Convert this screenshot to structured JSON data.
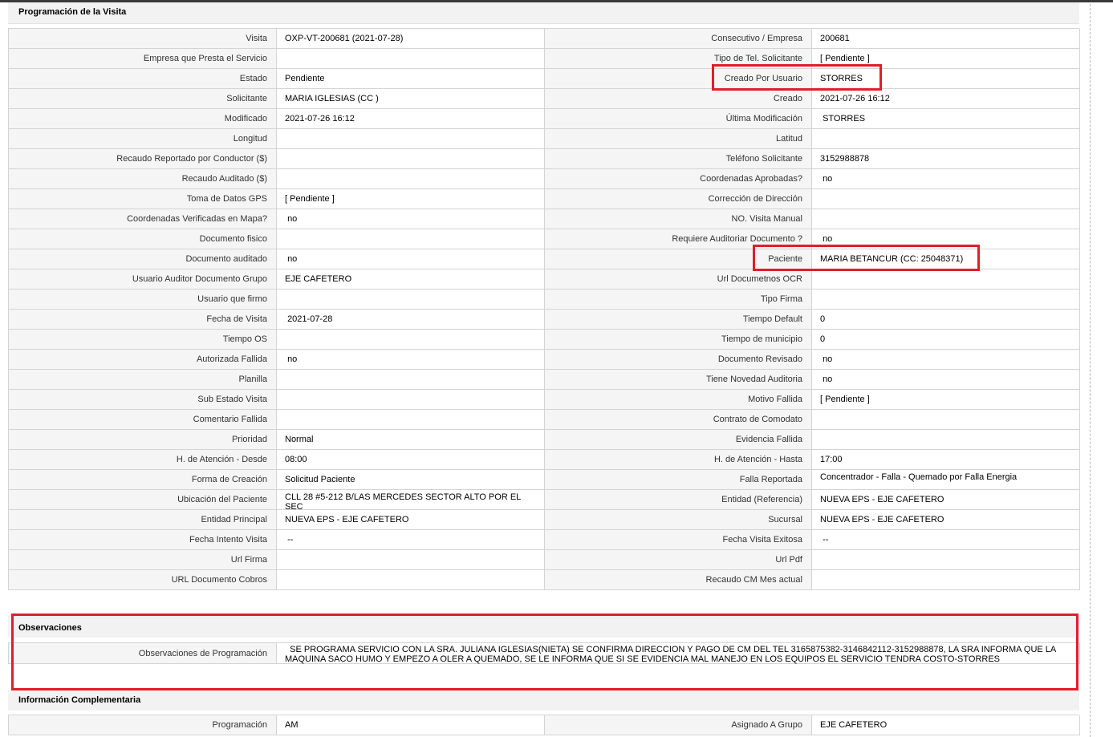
{
  "programacion": {
    "title": "Programación de la Visita",
    "rows": [
      [
        "Visita",
        "OXP-VT-200681 (2021-07-28)",
        "Consecutivo / Empresa",
        "200681"
      ],
      [
        "Empresa que Presta el Servicio",
        "",
        "Tipo de Tel. Solicitante",
        "[ Pendiente ]"
      ],
      [
        "Estado",
        "Pendiente",
        "Creado Por Usuario",
        "STORRES"
      ],
      [
        "Solicitante",
        "MARIA IGLESIAS (CC )",
        "Creado",
        "2021-07-26 16:12"
      ],
      [
        "Modificado",
        "2021-07-26 16:12",
        "Última Modificación",
        " STORRES"
      ],
      [
        "Longitud",
        "",
        "Latitud",
        ""
      ],
      [
        "Recaudo Reportado por Conductor ($)",
        "",
        "Teléfono Solicitante",
        "3152988878"
      ],
      [
        "Recaudo Auditado ($)",
        "",
        "Coordenadas Aprobadas?",
        " no"
      ],
      [
        "Toma de Datos GPS",
        "[ Pendiente ]",
        "Corrección de Dirección",
        ""
      ],
      [
        "Coordenadas Verificadas en Mapa?",
        " no",
        "NO. Visita Manual",
        ""
      ],
      [
        "Documento fisico",
        "",
        "Requiere Auditoriar Documento ?",
        " no"
      ],
      [
        "Documento auditado",
        " no",
        "Paciente",
        "MARIA BETANCUR (CC: 25048371)"
      ],
      [
        "Usuario Auditor Documento Grupo",
        "EJE CAFETERO",
        "Url Documetnos OCR",
        ""
      ],
      [
        "Usuario que firmo",
        "",
        "Tipo Firma",
        ""
      ],
      [
        "Fecha de Visita",
        " 2021-07-28",
        "Tiempo Default",
        "0"
      ],
      [
        "Tiempo OS",
        "",
        "Tiempo de municipio",
        "0"
      ],
      [
        "Autorizada Fallida",
        " no",
        "Documento Revisado",
        " no"
      ],
      [
        "Planilla",
        "",
        "Tiene Novedad Auditoria",
        " no"
      ],
      [
        "Sub Estado Visita",
        "",
        "Motivo Fallida",
        "[ Pendiente ]"
      ],
      [
        "Comentario Fallida",
        "",
        "Contrato de Comodato",
        ""
      ],
      [
        "Prioridad",
        "Normal",
        "Evidencia Fallida",
        ""
      ],
      [
        "H. de Atención - Desde",
        "08:00",
        "H. de Atención - Hasta",
        "17:00"
      ],
      [
        "Forma de Creación",
        "Solicitud Paciente",
        "Falla Reportada",
        "Concentrador - Falla - Quemado por Falla Energia"
      ],
      [
        "Ubicación del Paciente",
        "CLL 28 #5-212 B/LAS MERCEDES SECTOR ALTO POR EL SEC",
        "Entidad (Referencia)",
        "NUEVA EPS - EJE CAFETERO"
      ],
      [
        "Entidad Principal",
        "NUEVA EPS - EJE CAFETERO",
        "Sucursal",
        "NUEVA EPS - EJE CAFETERO"
      ],
      [
        "Fecha Intento Visita",
        " --",
        "Fecha Visita Exitosa",
        " --"
      ],
      [
        "Url Firma",
        "",
        "Url Pdf",
        ""
      ],
      [
        "URL Documento Cobros",
        "",
        "Recaudo CM Mes actual",
        ""
      ]
    ]
  },
  "observaciones": {
    "title": "Observaciones",
    "label": "Observaciones de Programación",
    "text": "  SE PROGRAMA SERVICIO CON LA SRA. JULIANA IGLESIAS(NIETA) SE CONFIRMA DIRECCION Y PAGO DE CM DEL TEL 3165875382-3146842112-3152988878, LA SRA INFORMA QUE LA MAQUINA SACO HUMO Y EMPEZO A OLER A QUEMADO, SE LE INFORMA QUE SI SE EVIDENCIA MAL MANEJO EN LOS EQUIPOS EL SERVICIO TENDRA COSTO-STORRES"
  },
  "complementaria": {
    "title": "Información Complementaria",
    "rows": [
      [
        "Programación",
        "AM",
        "Asignado A Grupo",
        "EJE CAFETERO"
      ]
    ]
  },
  "colors": {
    "highlight": "#e01e2a",
    "label_bg": "#f5f5f5",
    "header_bg": "#f2f2f2",
    "border": "#d4d4d4"
  }
}
